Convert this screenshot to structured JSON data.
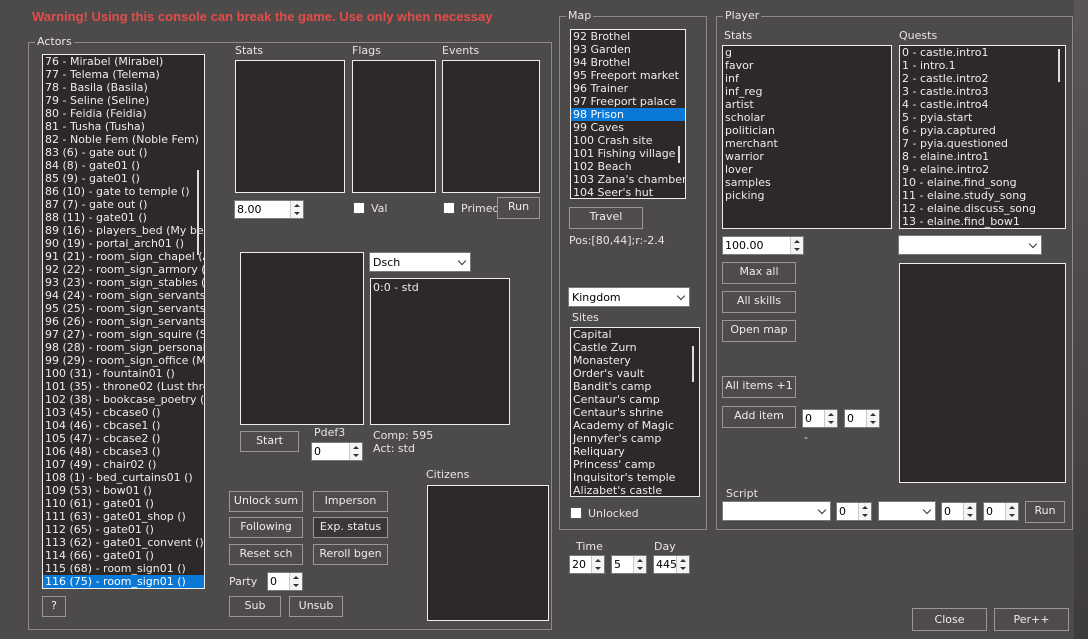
{
  "warning": "Warning! Using this console can break the game. Use only when necessay",
  "actors": {
    "title": "Actors",
    "items": [
      "76 - Mirabel (Mirabel)",
      "77 - Telema (Telema)",
      "78 - Basila (Basila)",
      "79 - Seline (Seline)",
      "80 - Feidia (Feidia)",
      "81 - Tusha (Tusha)",
      "82 - Noble Fem (Noble Fem)",
      "83 (6) - gate out ()",
      "84 (8) - gate01 ()",
      "85 (9) - gate01 ()",
      "86 (10) - gate to temple ()",
      "87 (7) - gate out ()",
      "88 (11) - gate01 ()",
      "89 (16) - players_bed (My bed)",
      "90 (19) - portal_arch01 ()",
      "91 (21) - room_sign_chapel (Alche",
      "92 (22) - room_sign_armory (Armor",
      "93 (23) - room_sign_stables (Stora",
      "94 (24) - room_sign_servants1 (Se",
      "95 (25) - room_sign_servants2 (Se",
      "96 (26) - room_sign_servants3 (Se",
      "97 (27) - room_sign_squire (Squire",
      "98 (28) - room_sign_personal ()",
      "99 (29) - room_sign_office (Map)",
      "100 (31) - fountain01 ()",
      "101 (35) - throne02 (Lust throne)",
      "102 (38) - bookcase_poetry (Book",
      "103 (45) - cbcase0 ()",
      "104 (46) - cbcase1 ()",
      "105 (47) - cbcase2 ()",
      "106 (48) - cbcase3 ()",
      "107 (49) - chair02 ()",
      "108 (1) - bed_curtains01 ()",
      "109 (53) - bow01 ()",
      "110 (61) - gate01 ()",
      "111 (63) - gate01_shop ()",
      "112 (65) - gate01 ()",
      "113 (62) - gate01_convent ()",
      "114 (66) - gate01 ()",
      "115 (68) - room_sign01 ()",
      "116 (75) - room_sign01 ()"
    ],
    "selected_index": 40,
    "help_label": "?"
  },
  "labels": {
    "stats": "Stats",
    "flags": "Flags",
    "events": "Events",
    "val": "Val",
    "primed": "Primed",
    "pdef3": "Pdef3",
    "comp": "Comp: 595",
    "act": "Act: std",
    "party": "Party",
    "citizens": "Citizens"
  },
  "stats_value": "8.00",
  "pdef3_value": "0",
  "party_value": "0",
  "dsch_select": "Dsch",
  "dsch_list": [
    "0:0 - std"
  ],
  "buttons": {
    "run": "Run",
    "start": "Start",
    "unlock_sum": "Unlock sum",
    "imperson": "Imperson",
    "following": "Following",
    "exp_status": "Exp. status",
    "reset_sch": "Reset sch",
    "reroll_bgen": "Reroll bgen",
    "sub": "Sub",
    "unsub": "Unsub"
  },
  "map": {
    "title": "Map",
    "items": [
      "92 Brothel",
      "93 Garden",
      "94 Brothel",
      "95 Freeport market",
      "96 Trainer",
      "97 Freeport palace",
      "98 Prison",
      "99 Caves",
      "100 Crash site",
      "101 Fishing village",
      "102 Beach",
      "103 Zana's chambers",
      "104 Seer's hut"
    ],
    "selected_index": 6,
    "travel_label": "Travel",
    "pos": "Pos:[80,44];r:-2.4",
    "kingdom_select": "Kingdom",
    "sites_label": "Sites",
    "sites": [
      "Capital",
      "Castle Zurn",
      "Monastery",
      "Order's vault",
      "Bandit's camp",
      "Centaur's camp",
      "Centaur's shrine",
      "Academy of Magic",
      "Jennyfer's camp",
      "Reliquary",
      "Princess' camp",
      "Inquisitor's temple",
      "Alizabet's castle"
    ],
    "unlocked_label": "Unlocked"
  },
  "time": {
    "time_label": "Time",
    "day_label": "Day",
    "hour": "20",
    "minute": "5",
    "day": "445"
  },
  "player": {
    "title": "Player",
    "stats_label": "Stats",
    "stats": [
      "g",
      "favor",
      "inf",
      "inf_reg",
      "artist",
      "scholar",
      "politician",
      "merchant",
      "warrior",
      "lover",
      "samples",
      "picking"
    ],
    "quests_label": "Quests",
    "quests": [
      "0 - castle.intro1",
      "1 - intro.1",
      "2 - castle.intro2",
      "3 - castle.intro3",
      "4 - castle.intro4",
      "5 - pyia.start",
      "6 - pyia.captured",
      "7 - pyia.questioned",
      "8 - elaine.intro1",
      "9 - elaine.intro2",
      "10 - elaine.find_song",
      "11 - elaine.study_song",
      "12 - elaine.discuss_song",
      "13 - elaine.find_bow1"
    ],
    "stat_value": "100.00",
    "max_all": "Max all",
    "all_skills": "All skills",
    "open_map": "Open map",
    "all_items": "All items +1",
    "add_item": "Add item",
    "item_a": "0",
    "item_b": "0",
    "dash": "-",
    "script_label": "Script",
    "script_a": "0",
    "script_b": "0",
    "script_c": "0",
    "run": "Run"
  },
  "footer": {
    "close": "Close",
    "per": "Per++"
  }
}
